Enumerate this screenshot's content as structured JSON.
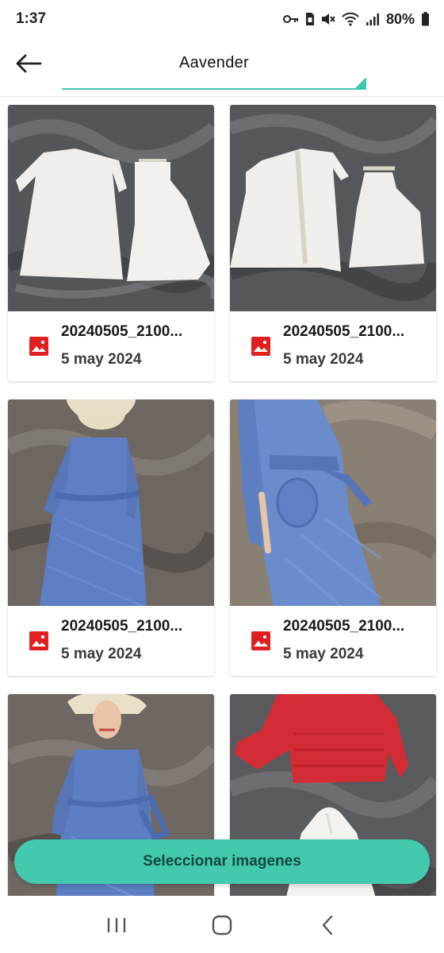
{
  "status_bar": {
    "time": "1:37",
    "battery": "80%",
    "icons": [
      "key-icon",
      "sim-icon",
      "mute-icon",
      "wifi-icon",
      "signal-icon",
      "battery-icon"
    ]
  },
  "header": {
    "title": "Aavender",
    "back_icon": "arrow-left-icon",
    "accent": "#3fc7b1"
  },
  "gallery": {
    "items": [
      {
        "filename": "20240505_2100...",
        "date": "5 may 2024",
        "icon": "image-icon"
      },
      {
        "filename": "20240505_2100...",
        "date": "5 may 2024",
        "icon": "image-icon"
      },
      {
        "filename": "20240505_2100...",
        "date": "5 may 2024",
        "icon": "image-icon"
      },
      {
        "filename": "20240505_2100...",
        "date": "5 may 2024",
        "icon": "image-icon"
      },
      {
        "filename": "",
        "date": "",
        "icon": "image-icon"
      },
      {
        "filename": "",
        "date": "",
        "icon": "image-icon"
      }
    ],
    "icon_color": "#e02020"
  },
  "select_button": {
    "label": "Seleccionar imagenes",
    "color": "#42c9ae"
  },
  "nav_bar": {
    "icons": [
      "recent-apps-icon",
      "home-icon",
      "back-icon"
    ]
  }
}
